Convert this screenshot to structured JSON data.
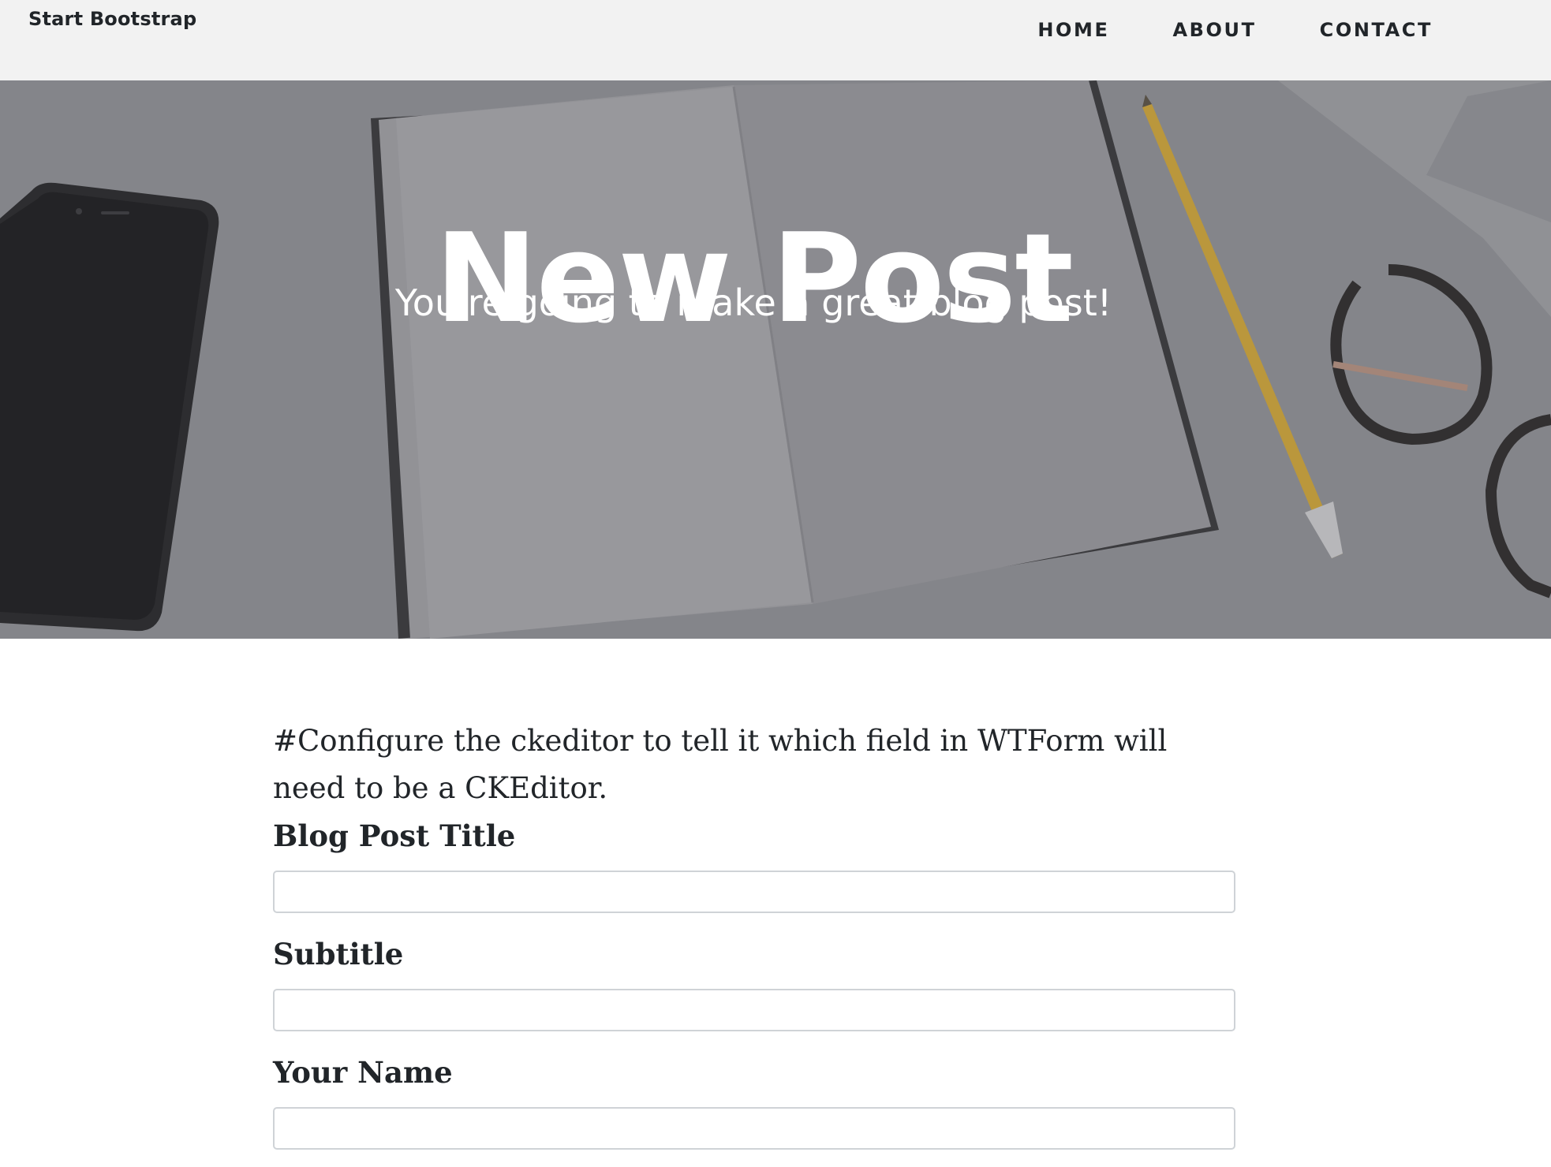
{
  "navbar": {
    "brand": "Start Bootstrap",
    "links": [
      {
        "label": "HOME"
      },
      {
        "label": "ABOUT"
      },
      {
        "label": "CONTACT"
      }
    ]
  },
  "hero": {
    "title": "New Post",
    "subtitle": "You're going to make a great blog post!"
  },
  "main": {
    "intro_text": "#Configure the ckeditor to tell it which field in WTForm will need to be a CKEditor.",
    "form": {
      "fields": [
        {
          "label": "Blog Post Title",
          "value": ""
        },
        {
          "label": "Subtitle",
          "value": ""
        },
        {
          "label": "Your Name",
          "value": ""
        }
      ]
    }
  },
  "colors": {
    "navbar_bg": "#f2f2f2",
    "hero_overlay": "#8a8b8f",
    "text_dark": "#212529",
    "text_light": "#ffffff",
    "input_border": "#cfd3d7"
  }
}
